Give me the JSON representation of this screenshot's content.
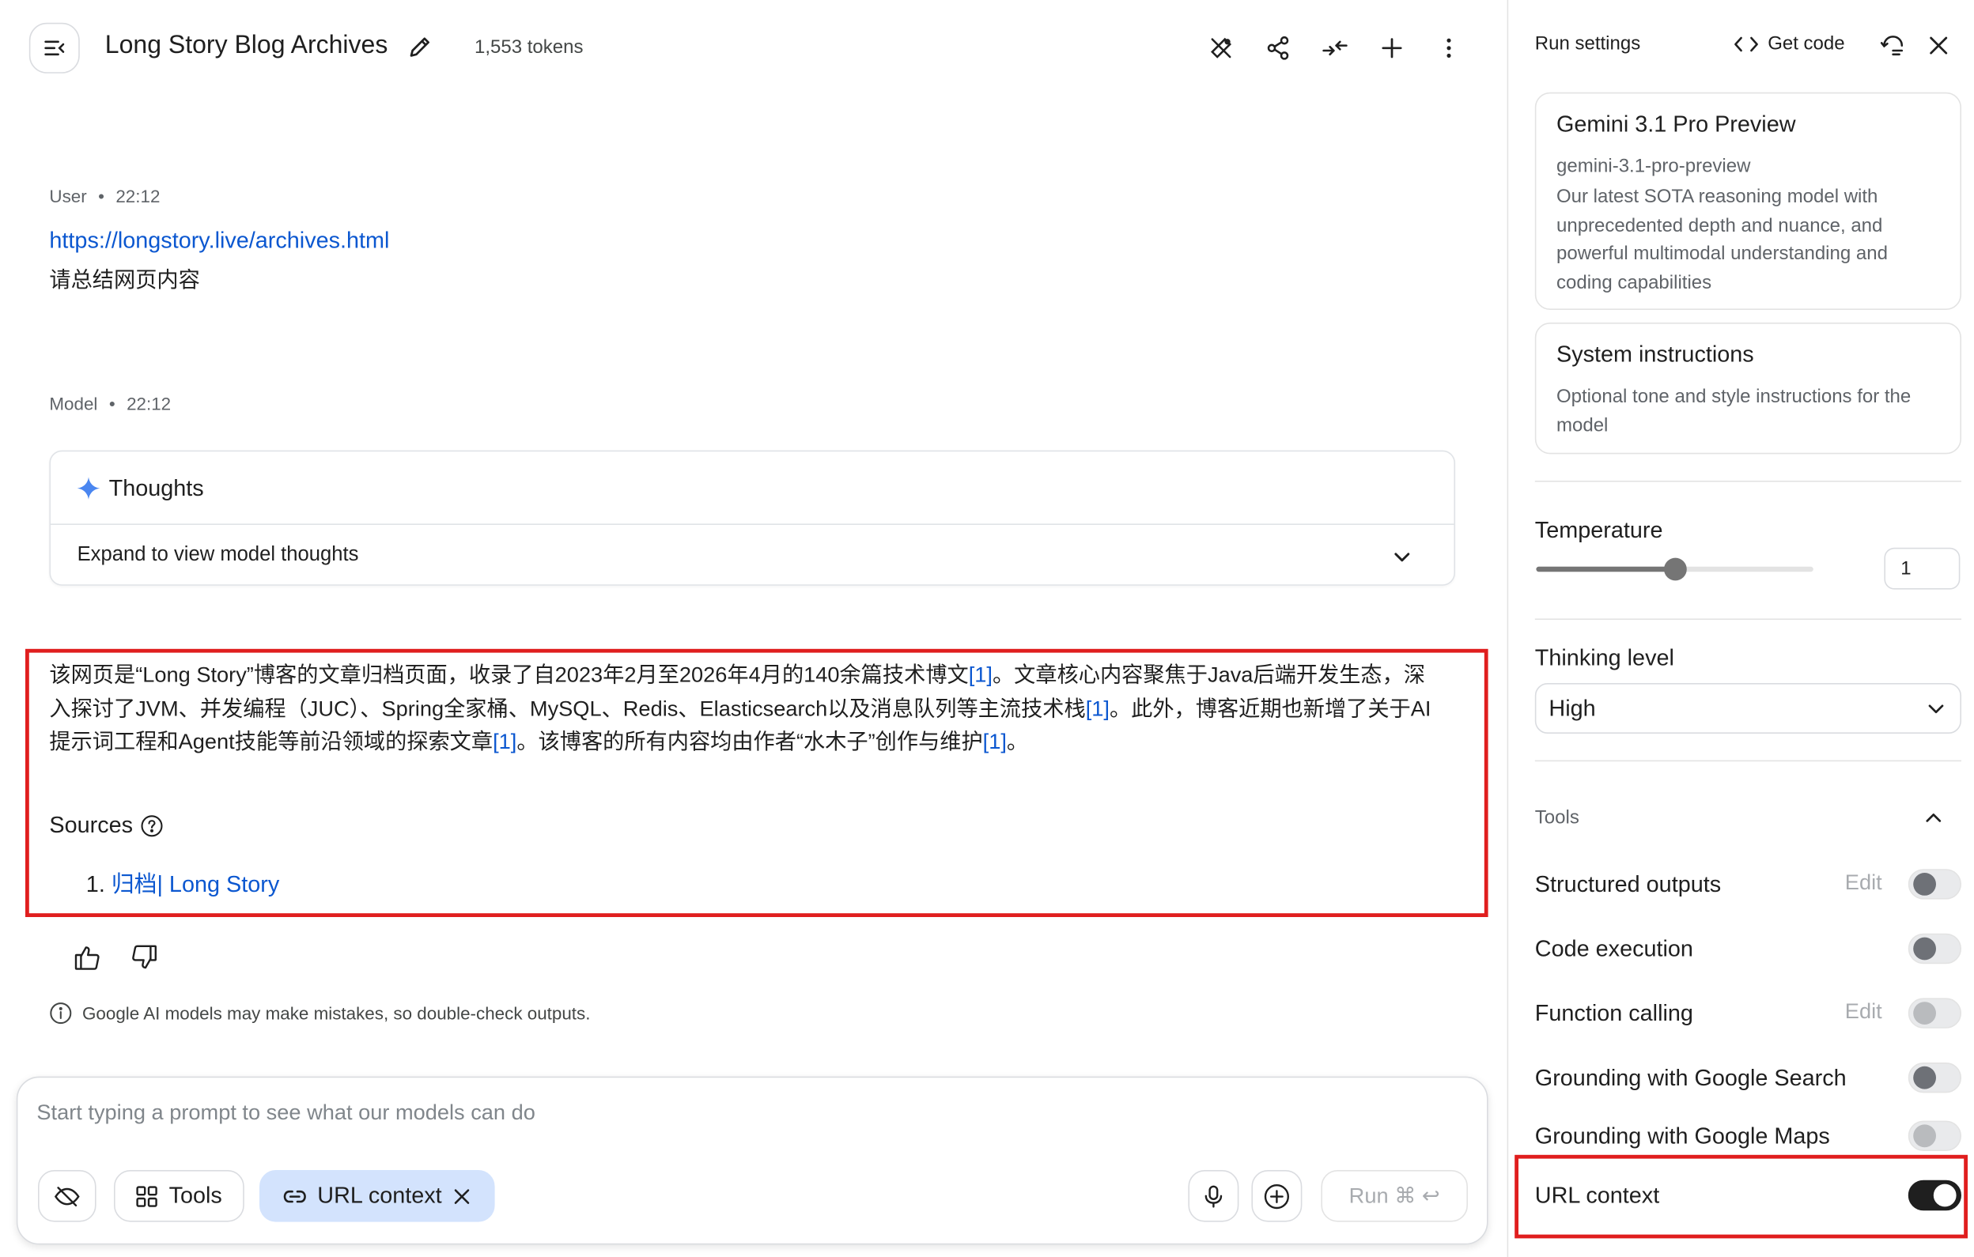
{
  "header": {
    "title": "Long Story Blog Archives",
    "tokens": "1,553 tokens"
  },
  "user_message": {
    "role": "User",
    "time": "22:12",
    "link": "https://longstory.live/archives.html",
    "text": "请总结网页内容"
  },
  "model_message": {
    "role": "Model",
    "time": "22:12",
    "thoughts_title": "Thoughts",
    "thoughts_expand": "Expand to view model thoughts",
    "answer_parts": [
      "该网页是“Long Story”博客的文章归档页面，收录了自2023年2月至2026年4月的140余篇技术博文",
      "[1]",
      "。文章核心内容聚焦于Java后端开发生态，深入探讨了JVM、并发编程（JUC）、Spring全家桶、MySQL、Redis、Elasticsearch以及消息队列等主流技术栈",
      "[1]",
      "。此外，博客近期也新增了关于AI提示词工程和Agent技能等前沿领域的探索文章",
      "[1]",
      "。该博客的所有内容均由作者“水木子”创作与维护",
      "[1]",
      "。"
    ],
    "sources_label": "Sources",
    "sources": [
      {
        "index": "1.",
        "title": "归档| Long Story"
      }
    ]
  },
  "disclaimer": "Google AI models may make mistakes, so double-check outputs.",
  "composer": {
    "placeholder": "Start typing a prompt to see what our models can do",
    "tools_label": "Tools",
    "url_chip": "URL context",
    "run_label": "Run ⌘ ↩"
  },
  "run_settings": {
    "title": "Run settings",
    "get_code": "Get code",
    "model": {
      "name": "Gemini 3.1 Pro Preview",
      "id": "gemini-3.1-pro-preview",
      "description": "Our latest SOTA reasoning model with unprecedented depth and nuance, and powerful multimodal understanding and coding capabilities"
    },
    "system_instructions": {
      "title": "System instructions",
      "placeholder": "Optional tone and style instructions for the model"
    },
    "temperature": {
      "label": "Temperature",
      "value": "1",
      "slider_fraction": 0.5
    },
    "thinking_level": {
      "label": "Thinking level",
      "value": "High"
    },
    "tools": {
      "label": "Tools",
      "edit_label": "Edit",
      "items": [
        {
          "label": "Structured outputs",
          "edit": true,
          "enabled": false,
          "disabled": false
        },
        {
          "label": "Code execution",
          "edit": false,
          "enabled": false,
          "disabled": false
        },
        {
          "label": "Function calling",
          "edit": true,
          "enabled": false,
          "disabled": true
        },
        {
          "label": "Grounding with Google Search",
          "edit": false,
          "enabled": false,
          "disabled": false
        },
        {
          "label": "Grounding with Google Maps",
          "edit": false,
          "enabled": false,
          "disabled": true
        },
        {
          "label": "URL context",
          "edit": false,
          "enabled": true,
          "disabled": false
        }
      ]
    }
  },
  "colors": {
    "link": "#0b57d0",
    "highlight_border": "#e01e1e",
    "chip_bg": "#d3e3fd",
    "toggle_on": "#1f1f1f"
  }
}
